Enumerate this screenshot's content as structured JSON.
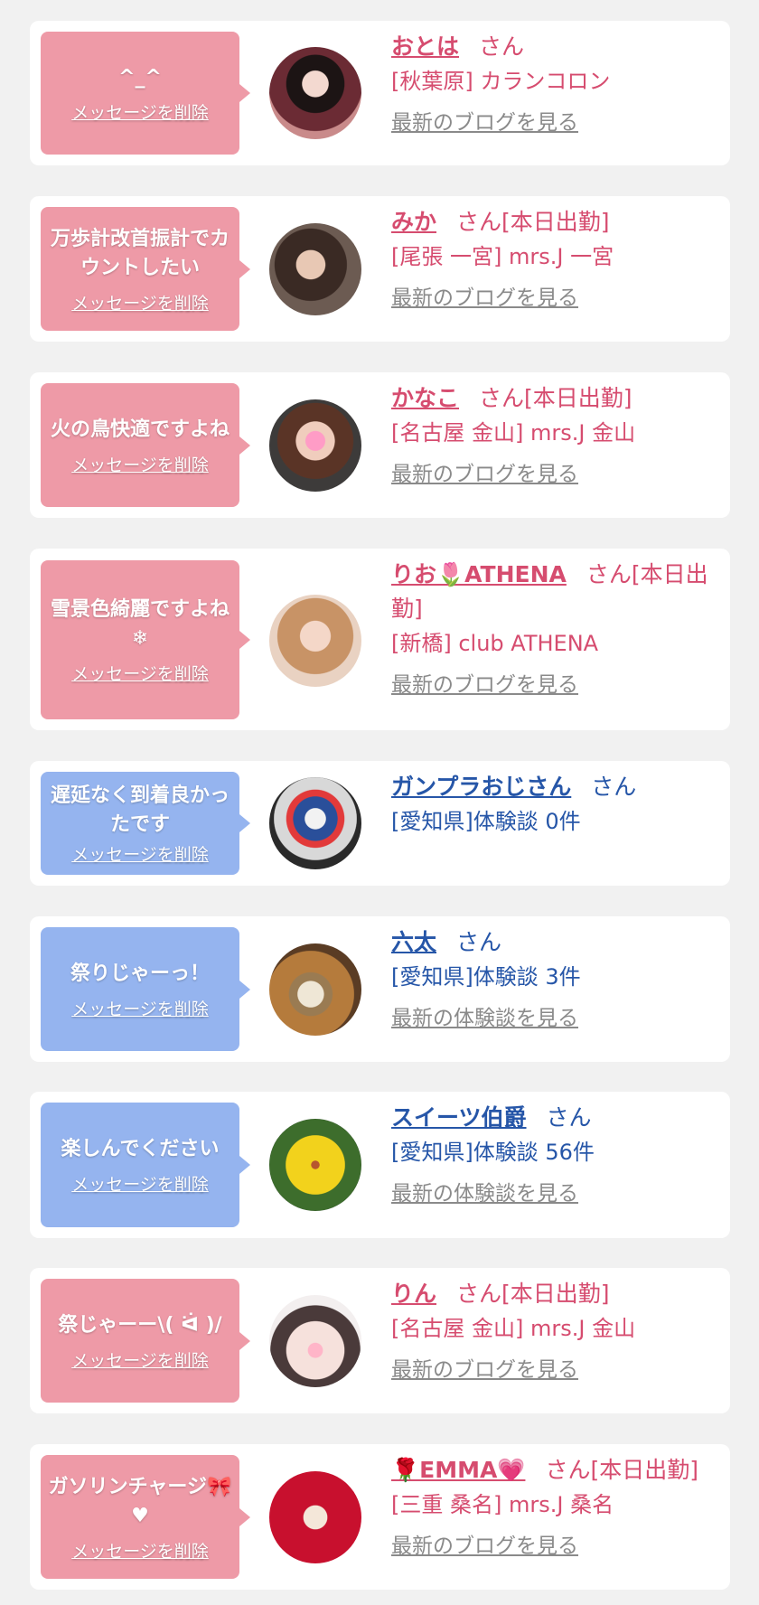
{
  "theme": {
    "cast_color": "#d64c6f",
    "user_color": "#2656a8",
    "pink_bubble": "#ee9aa7",
    "blue_bubble": "#95b4ef",
    "link_gray": "#8a8a8a"
  },
  "items": [
    {
      "message": "^_^",
      "delete_label": "メッセージを削除",
      "name": "おとは",
      "suffix": "さん",
      "shop": "[秋葉原] カランコロン",
      "link": "最新のブログを見る"
    },
    {
      "message": "万歩計改首振計でカウントしたい",
      "delete_label": "メッセージを削除",
      "name": "みか",
      "suffix": "さん[本日出勤]",
      "shop": "[尾張 一宮] mrs.J 一宮",
      "link": "最新のブログを見る"
    },
    {
      "message": "火の鳥快適ですよね",
      "delete_label": "メッセージを削除",
      "name": "かなこ",
      "suffix": "さん[本日出勤]",
      "shop": "[名古屋 金山] mrs.J 金山",
      "link": "最新のブログを見る"
    },
    {
      "message": "雪景色綺麗ですよね❄",
      "delete_label": "メッセージを削除",
      "name": "りお🌷ATHENA",
      "suffix": "さん[本日出勤]",
      "shop": "[新橋] club ATHENA",
      "link": "最新のブログを見る"
    },
    {
      "message": "遅延なく到着良かったです",
      "delete_label": "メッセージを削除",
      "name": "ガンプラおじさん",
      "suffix": "さん",
      "shop": "[愛知県]体験談 0件",
      "link": ""
    },
    {
      "message": "祭りじゃーっ！",
      "delete_label": "メッセージを削除",
      "name": "六太",
      "suffix": "さん",
      "shop": "[愛知県]体験談 3件",
      "link": "最新の体験談を見る"
    },
    {
      "message": "楽しんでください",
      "delete_label": "メッセージを削除",
      "name": "スイーツ伯爵",
      "suffix": "さん",
      "shop": "[愛知県]体験談 56件",
      "link": "最新の体験談を見る"
    },
    {
      "message": "祭じゃーー\\( ᐛ )/",
      "delete_label": "メッセージを削除",
      "name": "りん",
      "suffix": "さん[本日出勤]",
      "shop": "[名古屋 金山] mrs.J 金山",
      "link": "最新のブログを見る"
    },
    {
      "message": "ガソリンチャージ🎀♥",
      "delete_label": "メッセージを削除",
      "name": "🌹EMMA💗",
      "suffix": "さん[本日出勤]",
      "shop": "[三重 桑名] mrs.J 桑名",
      "link": "最新のブログを見る"
    }
  ]
}
